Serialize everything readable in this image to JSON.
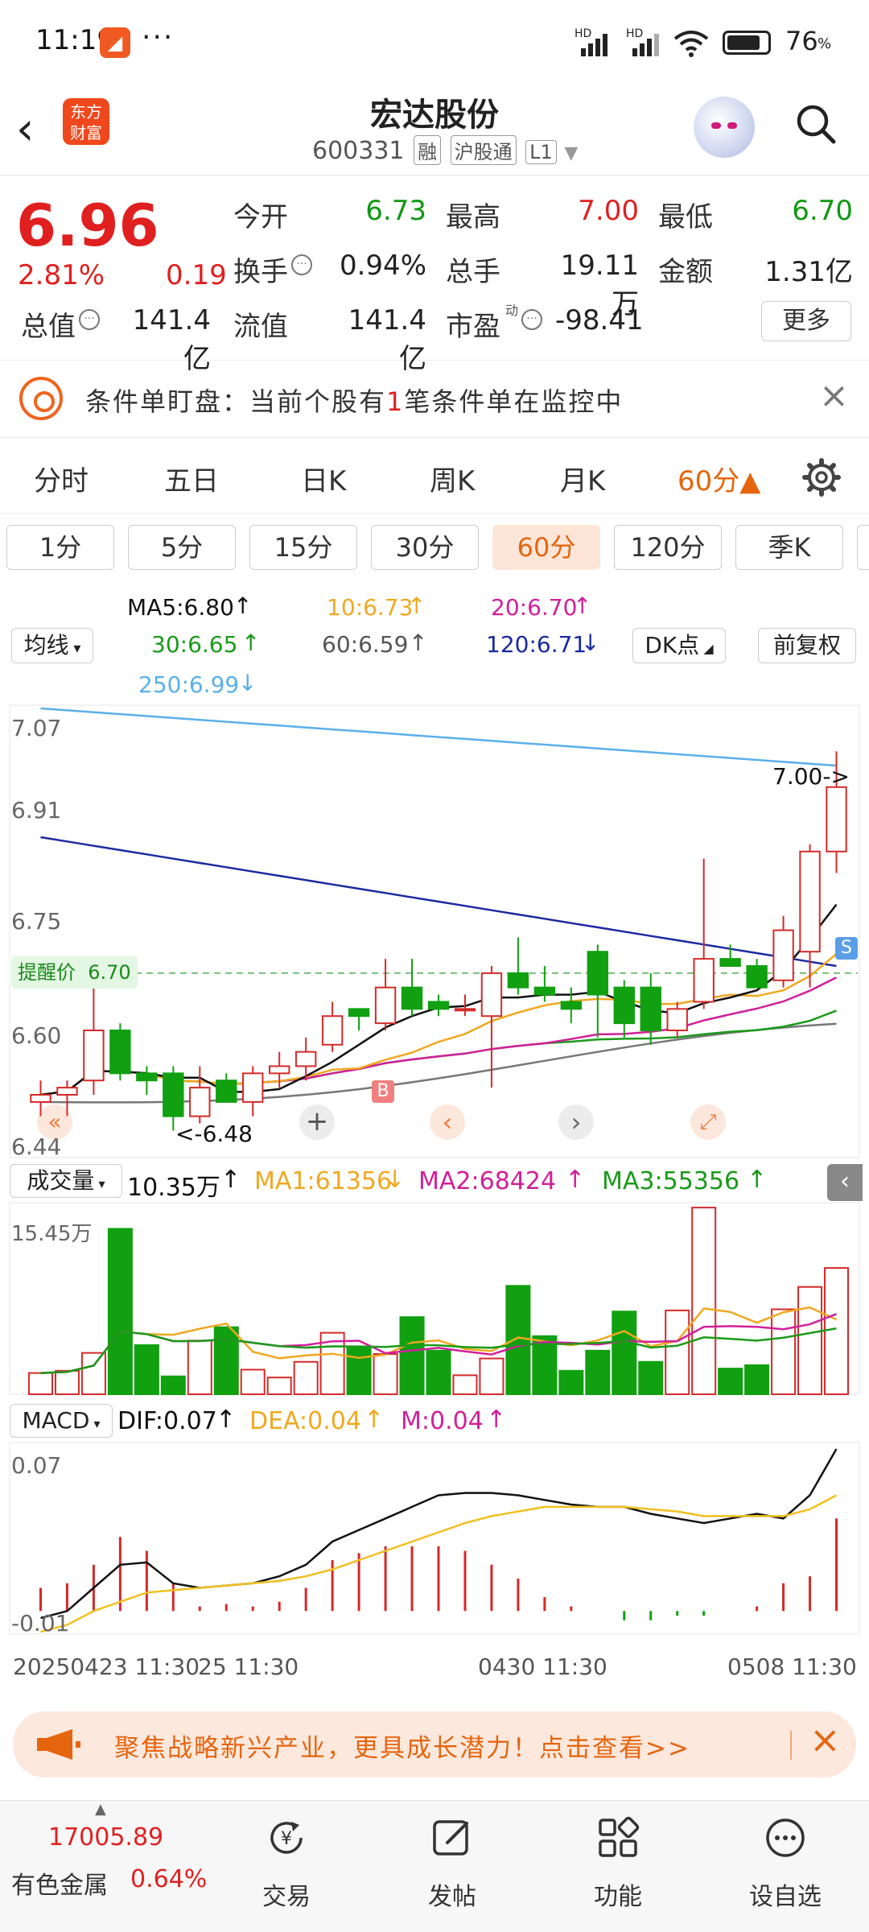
{
  "status_bar": {
    "time": "11:19",
    "app_badge": "◢",
    "dots": "···",
    "signal1": "HD",
    "signal2": "HD",
    "battery": "76"
  },
  "header": {
    "back_icon": "chevron-left-icon",
    "logo_line1": "东方",
    "logo_line2": "财富",
    "stock_name": "宏达股份",
    "stock_code": "600331",
    "tags": [
      "融",
      "沪股通",
      "L1"
    ]
  },
  "quote": {
    "price": "6.96",
    "pct": "2.81%",
    "change": "0.19",
    "rows": [
      [
        {
          "label": "今开",
          "value": "6.73",
          "color": "green"
        },
        {
          "label": "最高",
          "value": "7.00",
          "color": "red"
        },
        {
          "label": "最低",
          "value": "6.70",
          "color": "green"
        }
      ],
      [
        {
          "label": "换手",
          "value": "0.94%",
          "color": "dark"
        },
        {
          "label": "总手",
          "value": "19.11万",
          "color": "dark"
        },
        {
          "label": "金额",
          "value": "1.31亿",
          "color": "dark"
        }
      ],
      [
        {
          "label": "总值",
          "value": "141.4亿",
          "color": "dark"
        },
        {
          "label": "流值",
          "value": "141.4亿",
          "color": "dark"
        },
        {
          "label": "市盈",
          "value": "-98.41",
          "color": "dark"
        }
      ]
    ],
    "pe_superscript": "动",
    "more_label": "更多"
  },
  "alert": {
    "text_before": "条件单盯盘：当前个股有",
    "count": "1",
    "text_after": "笔条件单在监控中",
    "close": "×"
  },
  "period_tabs": [
    "分时",
    "五日",
    "日K",
    "周K",
    "月K",
    "60分▲"
  ],
  "active_period": "60分▲",
  "sub_tabs": [
    "1分",
    "5分",
    "15分",
    "30分",
    "60分",
    "120分",
    "季K"
  ],
  "active_sub_tab": "60分",
  "ma_legend": {
    "selector": "均线",
    "ma5": "MA5:6.80",
    "ma10": "10:6.73",
    "ma20": "20:6.70",
    "ma30": "30:6.65",
    "ma60": "60:6.59",
    "ma120": "120:6.71",
    "ma250": "250:6.99",
    "dk_label": "DK点",
    "fq_label": "前复权"
  },
  "kline": {
    "y_labels": [
      "7.07",
      "6.91",
      "6.75",
      "6.60",
      "6.44"
    ],
    "alert_label": "提醒价",
    "alert_value": "6.70",
    "high_mark": "7.00->",
    "low_mark": "<-6.48",
    "buy_marker": "B",
    "sell_marker": "S",
    "colors": {
      "up": "#d42a2a",
      "down": "#10a010",
      "ma5": "#111111",
      "ma10": "#f0a820",
      "ma20": "#d0209a",
      "ma30": "#1a9a1a",
      "ma60": "#777777",
      "ma120": "#1a2aa0",
      "ma250": "#5ab0e8"
    }
  },
  "volume": {
    "selector": "成交量",
    "total": "10.35万",
    "ma1": "MA1:61356",
    "ma2": "MA2:68424",
    "ma3": "MA3:55356",
    "y_label": "15.45万"
  },
  "macd": {
    "selector": "MACD",
    "dif": "DIF:0.07",
    "dea": "DEA:0.04",
    "m": "M:0.04",
    "y_top": "0.07",
    "y_bottom": "-0.01"
  },
  "x_axis": {
    "label1": "20250423  11:30",
    "label2": "25  11:30",
    "label3": "0430  11:30",
    "label4": "0508  11:30"
  },
  "banner": {
    "text": "聚焦战略新兴产业，更具成长潜力！点击查看>>",
    "close": "×"
  },
  "bottom_nav": {
    "index_value": "17005.89",
    "index_name": "有色金属",
    "index_pct": "0.64%",
    "items": [
      {
        "label": "交易",
        "icon": "trade-icon"
      },
      {
        "label": "发帖",
        "icon": "post-icon"
      },
      {
        "label": "功能",
        "icon": "function-icon"
      },
      {
        "label": "设自选",
        "icon": "more-icon"
      }
    ]
  },
  "chart_data": {
    "type": "candlestick",
    "ylim": [
      6.44,
      7.07
    ],
    "y_ticks": [
      "7.07",
      "6.91",
      "6.75",
      "6.60",
      "6.44"
    ],
    "x_ticks": [
      "20250423 11:30",
      "25 11:30",
      "0430 11:30",
      "0508 11:30"
    ],
    "ohlc": [
      [
        6.52,
        6.55,
        6.5,
        6.53
      ],
      [
        6.53,
        6.55,
        6.5,
        6.54
      ],
      [
        6.55,
        6.7,
        6.53,
        6.62
      ],
      [
        6.62,
        6.63,
        6.55,
        6.56
      ],
      [
        6.56,
        6.57,
        6.53,
        6.55
      ],
      [
        6.56,
        6.57,
        6.48,
        6.5
      ],
      [
        6.5,
        6.57,
        6.49,
        6.54
      ],
      [
        6.55,
        6.56,
        6.52,
        6.52
      ],
      [
        6.52,
        6.57,
        6.5,
        6.56
      ],
      [
        6.56,
        6.59,
        6.54,
        6.57
      ],
      [
        6.57,
        6.61,
        6.55,
        6.59
      ],
      [
        6.6,
        6.66,
        6.59,
        6.64
      ],
      [
        6.65,
        6.65,
        6.62,
        6.64
      ],
      [
        6.63,
        6.72,
        6.62,
        6.68
      ],
      [
        6.68,
        6.72,
        6.64,
        6.65
      ],
      [
        6.66,
        6.67,
        6.64,
        6.65
      ],
      [
        6.65,
        6.67,
        6.64,
        6.65
      ],
      [
        6.64,
        6.71,
        6.54,
        6.7
      ],
      [
        6.7,
        6.75,
        6.67,
        6.68
      ],
      [
        6.68,
        6.71,
        6.66,
        6.67
      ],
      [
        6.66,
        6.68,
        6.63,
        6.65
      ],
      [
        6.73,
        6.74,
        6.61,
        6.67
      ],
      [
        6.68,
        6.69,
        6.61,
        6.63
      ],
      [
        6.68,
        6.7,
        6.6,
        6.62
      ],
      [
        6.62,
        6.66,
        6.61,
        6.65
      ],
      [
        6.66,
        6.86,
        6.65,
        6.72
      ],
      [
        6.72,
        6.74,
        6.71,
        6.71
      ],
      [
        6.71,
        6.72,
        6.68,
        6.68
      ],
      [
        6.69,
        6.78,
        6.68,
        6.76
      ],
      [
        6.73,
        6.88,
        6.68,
        6.87
      ],
      [
        6.87,
        7.01,
        6.84,
        6.96
      ]
    ],
    "volume_ylim": [
      0,
      15.45
    ],
    "volume": [
      1.9,
      2.1,
      3.7,
      14.8,
      4.4,
      1.6,
      4.8,
      6.0,
      2.2,
      1.5,
      2.9,
      5.5,
      4.2,
      3.6,
      6.9,
      3.9,
      1.7,
      3.2,
      9.7,
      5.2,
      2.1,
      3.9,
      7.4,
      2.9,
      7.5,
      16.7,
      2.3,
      2.6,
      7.6,
      9.6,
      11.3
    ],
    "macd_ylim": [
      -0.01,
      0.07
    ],
    "dif": [
      -0.003,
      0.0,
      0.01,
      0.02,
      0.021,
      0.012,
      0.01,
      0.011,
      0.012,
      0.015,
      0.02,
      0.03,
      0.035,
      0.04,
      0.045,
      0.05,
      0.051,
      0.051,
      0.05,
      0.048,
      0.046,
      0.045,
      0.045,
      0.042,
      0.04,
      0.038,
      0.04,
      0.042,
      0.04,
      0.05,
      0.07
    ],
    "dea": [
      -0.009,
      -0.006,
      0.0,
      0.004,
      0.008,
      0.009,
      0.01,
      0.011,
      0.012,
      0.013,
      0.015,
      0.018,
      0.022,
      0.026,
      0.03,
      0.034,
      0.038,
      0.041,
      0.043,
      0.045,
      0.045,
      0.045,
      0.045,
      0.044,
      0.043,
      0.041,
      0.041,
      0.041,
      0.041,
      0.044,
      0.05
    ],
    "m": [
      0.01,
      0.012,
      0.02,
      0.032,
      0.026,
      0.012,
      0.002,
      0.003,
      0.002,
      0.004,
      0.01,
      0.022,
      0.025,
      0.028,
      0.028,
      0.028,
      0.026,
      0.02,
      0.014,
      0.006,
      0.002,
      0.0,
      -0.004,
      -0.004,
      -0.002,
      -0.002,
      0.0,
      0.002,
      0.012,
      0.015,
      0.04
    ]
  }
}
